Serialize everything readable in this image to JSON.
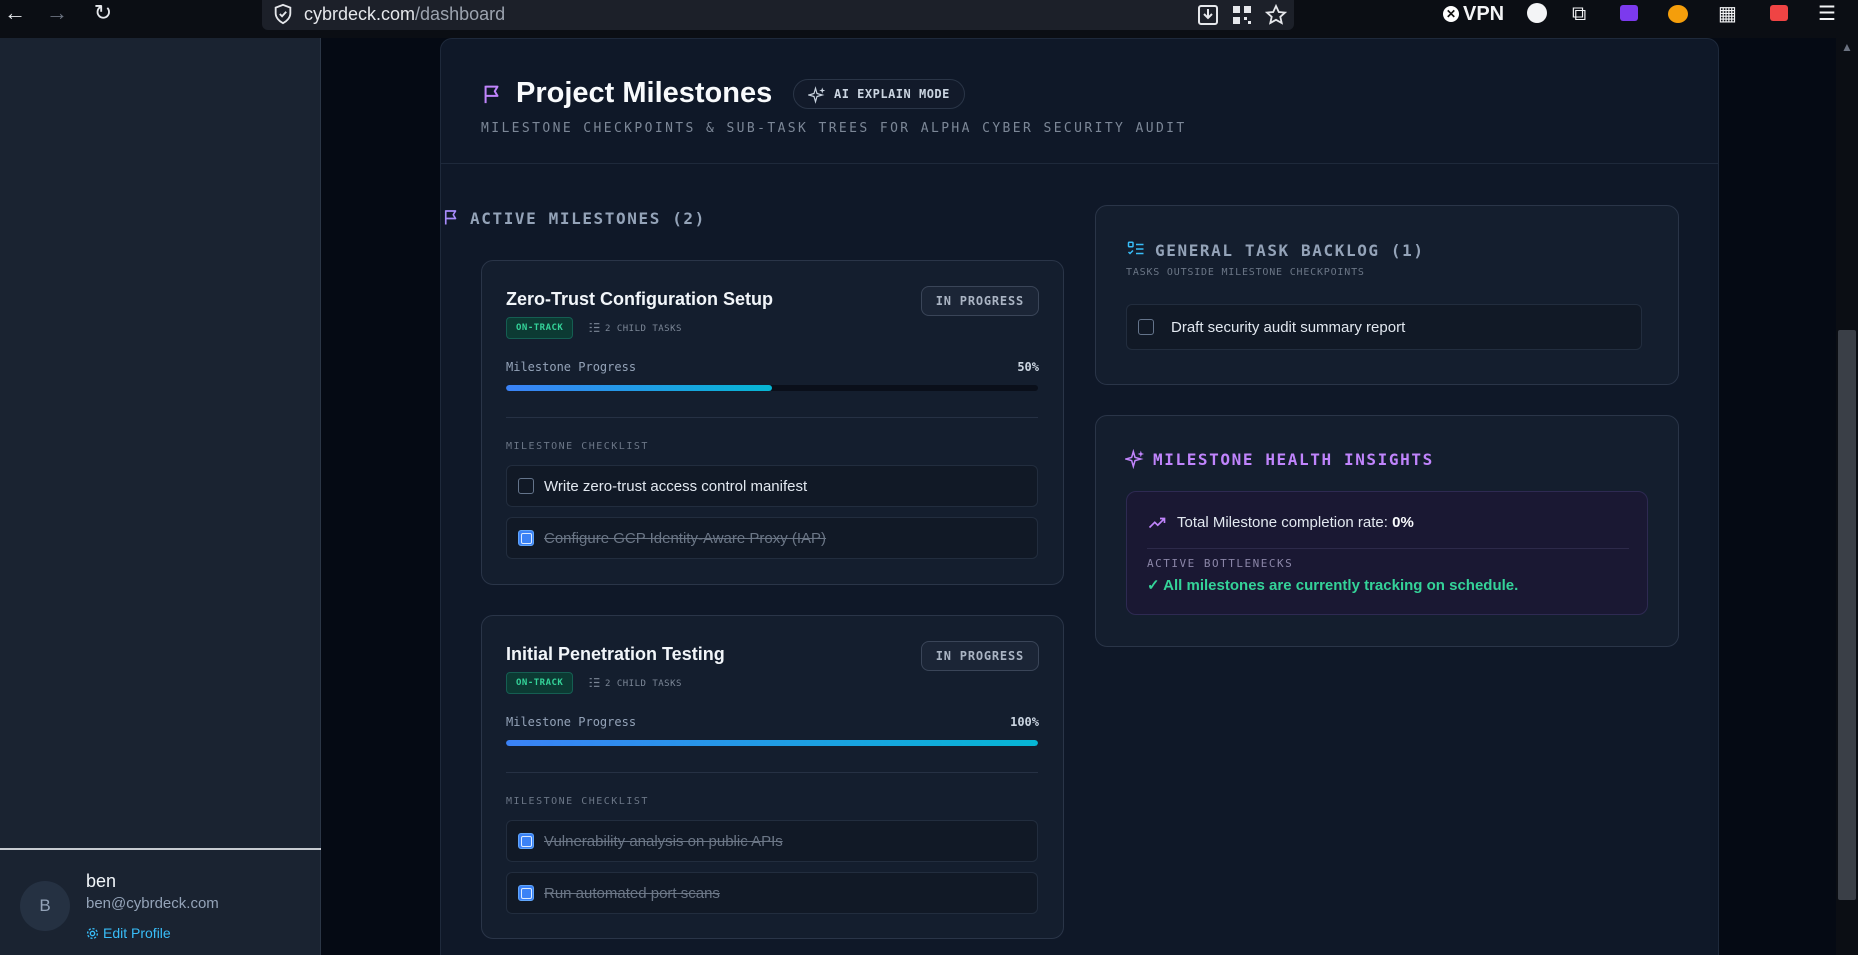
{
  "browser": {
    "url_host": "cybrdeck.com",
    "url_path": "/dashboard",
    "vpn_label": "VPN"
  },
  "sidebar": {
    "user": {
      "avatar_initial": "B",
      "name": "ben",
      "email": "ben@cybrdeck.com",
      "edit_label": "Edit Profile"
    }
  },
  "header": {
    "title": "Project Milestones",
    "ai_button": "AI EXPLAIN MODE",
    "subtitle": "MILESTONE CHECKPOINTS & SUB-TASK TREES FOR ALPHA CYBER SECURITY AUDIT"
  },
  "active_milestones": {
    "heading": "ACTIVE MILESTONES (2)",
    "items": [
      {
        "title": "Zero-Trust Configuration Setup",
        "status": "IN PROGRESS",
        "health": "ON-TRACK",
        "child_tasks": "2 CHILD TASKS",
        "progress_label": "Milestone Progress",
        "progress_text": "50%",
        "progress": 0.5,
        "checklist_label": "MILESTONE CHECKLIST",
        "tasks": [
          {
            "text": "Write zero-trust access control manifest",
            "done": false
          },
          {
            "text": "Configure GCP Identity-Aware Proxy (IAP)",
            "done": true
          }
        ]
      },
      {
        "title": "Initial Penetration Testing",
        "status": "IN PROGRESS",
        "health": "ON-TRACK",
        "child_tasks": "2 CHILD TASKS",
        "progress_label": "Milestone Progress",
        "progress_text": "100%",
        "progress": 1.0,
        "checklist_label": "MILESTONE CHECKLIST",
        "tasks": [
          {
            "text": "Vulnerability analysis on public APIs",
            "done": true
          },
          {
            "text": "Run automated port scans",
            "done": true
          }
        ]
      }
    ]
  },
  "backlog": {
    "heading": "GENERAL TASK BACKLOG (1)",
    "subheading": "TASKS OUTSIDE MILESTONE CHECKPOINTS",
    "items": [
      {
        "text": "Draft security audit summary report",
        "done": false
      }
    ]
  },
  "health": {
    "heading": "MILESTONE HEALTH INSIGHTS",
    "completion_label": "Total Milestone completion rate: ",
    "completion_value": "0%",
    "bottlenecks_label": "ACTIVE BOTTLENECKS",
    "bottlenecks_msg": "✓ All milestones are currently tracking on schedule."
  },
  "colors": {
    "accent_purple": "#c084fc",
    "accent_cyan": "#06b6d4",
    "accent_blue": "#3b82f6",
    "success_green": "#34d399"
  }
}
